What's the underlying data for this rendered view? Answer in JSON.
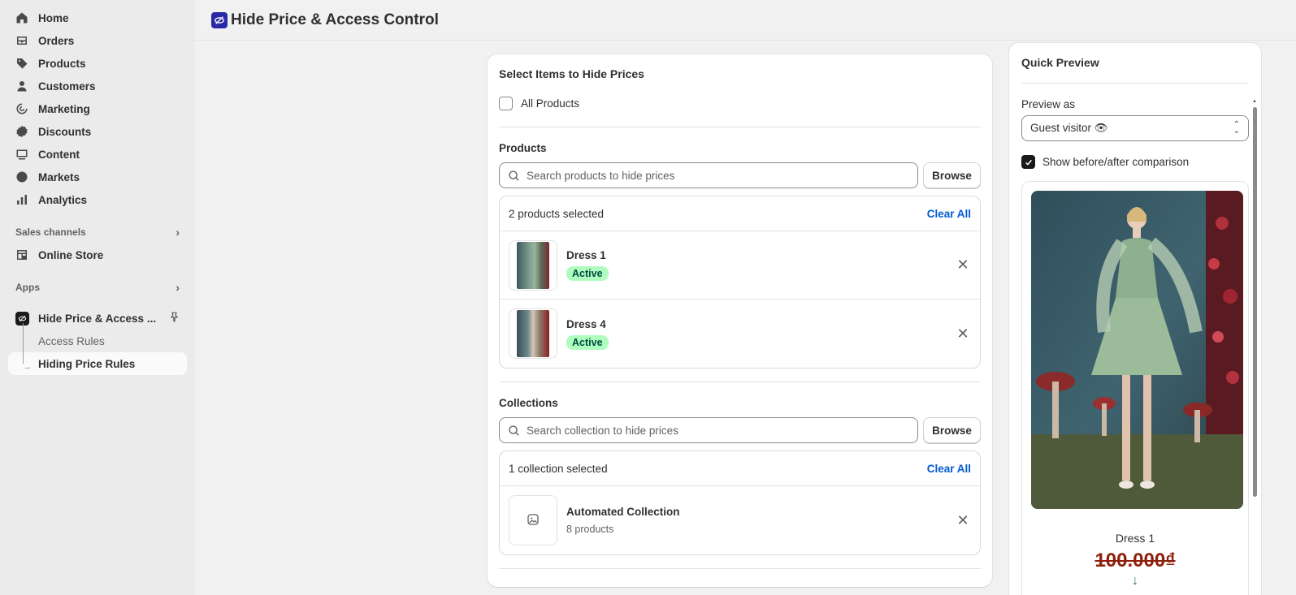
{
  "sidebar": {
    "nav": [
      {
        "label": "Home",
        "icon": "home-icon"
      },
      {
        "label": "Orders",
        "icon": "orders-icon"
      },
      {
        "label": "Products",
        "icon": "tag-icon"
      },
      {
        "label": "Customers",
        "icon": "person-icon"
      },
      {
        "label": "Marketing",
        "icon": "target-icon"
      },
      {
        "label": "Discounts",
        "icon": "discount-icon"
      },
      {
        "label": "Content",
        "icon": "content-icon"
      },
      {
        "label": "Markets",
        "icon": "globe-icon"
      },
      {
        "label": "Analytics",
        "icon": "chart-bars-icon"
      }
    ],
    "sales_channels_label": "Sales channels",
    "online_store_label": "Online Store",
    "apps_label": "Apps",
    "app_name": "Hide Price & Access ...",
    "sub_items": [
      {
        "label": "Access Rules"
      },
      {
        "label": "Hiding Price Rules"
      }
    ]
  },
  "header": {
    "title": "Hide Price & Access Control"
  },
  "main": {
    "card_title": "Select Items to Hide Prices",
    "all_products_label": "All Products",
    "all_products_checked": false,
    "products": {
      "label": "Products",
      "search_placeholder": "Search products to hide prices",
      "browse_label": "Browse",
      "selected_text": "2 products selected",
      "clear_label": "Clear All",
      "items": [
        {
          "name": "Dress 1",
          "status": "Active"
        },
        {
          "name": "Dress 4",
          "status": "Active"
        }
      ]
    },
    "collections": {
      "label": "Collections",
      "search_placeholder": "Search collection to hide prices",
      "browse_label": "Browse",
      "selected_text": "1 collection selected",
      "clear_label": "Clear All",
      "items": [
        {
          "name": "Automated Collection",
          "sub": "8 products"
        }
      ]
    }
  },
  "preview": {
    "title": "Quick Preview",
    "preview_as_label": "Preview as",
    "preview_as_value": "Guest visitor 👁",
    "comparison_label": "Show before/after comparison",
    "comparison_checked": true,
    "product_name": "Dress 1",
    "old_price": "100.000₫",
    "arrow": "↓"
  },
  "colors": {
    "accent_link": "#005bd3",
    "badge_bg": "#affebf",
    "price_red": "#8e1f0b"
  }
}
